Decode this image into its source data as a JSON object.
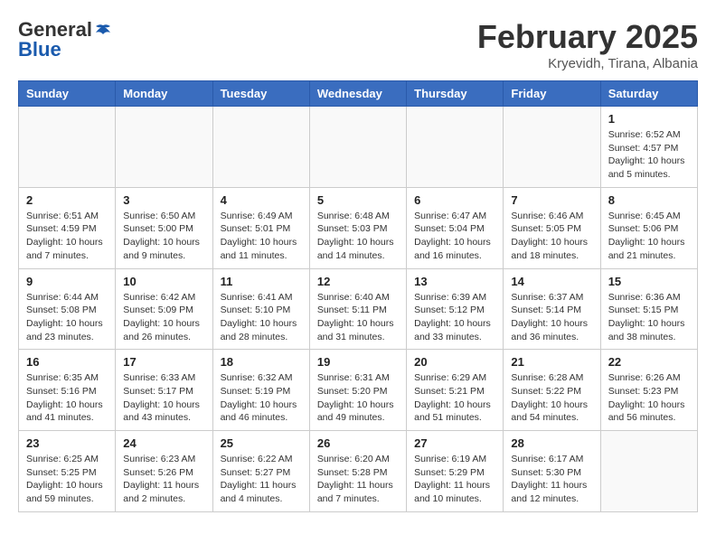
{
  "header": {
    "logo_general": "General",
    "logo_blue": "Blue",
    "title": "February 2025",
    "location": "Kryevidh, Tirana, Albania"
  },
  "weekdays": [
    "Sunday",
    "Monday",
    "Tuesday",
    "Wednesday",
    "Thursday",
    "Friday",
    "Saturday"
  ],
  "weeks": [
    [
      {
        "day": "",
        "info": ""
      },
      {
        "day": "",
        "info": ""
      },
      {
        "day": "",
        "info": ""
      },
      {
        "day": "",
        "info": ""
      },
      {
        "day": "",
        "info": ""
      },
      {
        "day": "",
        "info": ""
      },
      {
        "day": "1",
        "info": "Sunrise: 6:52 AM\nSunset: 4:57 PM\nDaylight: 10 hours\nand 5 minutes."
      }
    ],
    [
      {
        "day": "2",
        "info": "Sunrise: 6:51 AM\nSunset: 4:59 PM\nDaylight: 10 hours\nand 7 minutes."
      },
      {
        "day": "3",
        "info": "Sunrise: 6:50 AM\nSunset: 5:00 PM\nDaylight: 10 hours\nand 9 minutes."
      },
      {
        "day": "4",
        "info": "Sunrise: 6:49 AM\nSunset: 5:01 PM\nDaylight: 10 hours\nand 11 minutes."
      },
      {
        "day": "5",
        "info": "Sunrise: 6:48 AM\nSunset: 5:03 PM\nDaylight: 10 hours\nand 14 minutes."
      },
      {
        "day": "6",
        "info": "Sunrise: 6:47 AM\nSunset: 5:04 PM\nDaylight: 10 hours\nand 16 minutes."
      },
      {
        "day": "7",
        "info": "Sunrise: 6:46 AM\nSunset: 5:05 PM\nDaylight: 10 hours\nand 18 minutes."
      },
      {
        "day": "8",
        "info": "Sunrise: 6:45 AM\nSunset: 5:06 PM\nDaylight: 10 hours\nand 21 minutes."
      }
    ],
    [
      {
        "day": "9",
        "info": "Sunrise: 6:44 AM\nSunset: 5:08 PM\nDaylight: 10 hours\nand 23 minutes."
      },
      {
        "day": "10",
        "info": "Sunrise: 6:42 AM\nSunset: 5:09 PM\nDaylight: 10 hours\nand 26 minutes."
      },
      {
        "day": "11",
        "info": "Sunrise: 6:41 AM\nSunset: 5:10 PM\nDaylight: 10 hours\nand 28 minutes."
      },
      {
        "day": "12",
        "info": "Sunrise: 6:40 AM\nSunset: 5:11 PM\nDaylight: 10 hours\nand 31 minutes."
      },
      {
        "day": "13",
        "info": "Sunrise: 6:39 AM\nSunset: 5:12 PM\nDaylight: 10 hours\nand 33 minutes."
      },
      {
        "day": "14",
        "info": "Sunrise: 6:37 AM\nSunset: 5:14 PM\nDaylight: 10 hours\nand 36 minutes."
      },
      {
        "day": "15",
        "info": "Sunrise: 6:36 AM\nSunset: 5:15 PM\nDaylight: 10 hours\nand 38 minutes."
      }
    ],
    [
      {
        "day": "16",
        "info": "Sunrise: 6:35 AM\nSunset: 5:16 PM\nDaylight: 10 hours\nand 41 minutes."
      },
      {
        "day": "17",
        "info": "Sunrise: 6:33 AM\nSunset: 5:17 PM\nDaylight: 10 hours\nand 43 minutes."
      },
      {
        "day": "18",
        "info": "Sunrise: 6:32 AM\nSunset: 5:19 PM\nDaylight: 10 hours\nand 46 minutes."
      },
      {
        "day": "19",
        "info": "Sunrise: 6:31 AM\nSunset: 5:20 PM\nDaylight: 10 hours\nand 49 minutes."
      },
      {
        "day": "20",
        "info": "Sunrise: 6:29 AM\nSunset: 5:21 PM\nDaylight: 10 hours\nand 51 minutes."
      },
      {
        "day": "21",
        "info": "Sunrise: 6:28 AM\nSunset: 5:22 PM\nDaylight: 10 hours\nand 54 minutes."
      },
      {
        "day": "22",
        "info": "Sunrise: 6:26 AM\nSunset: 5:23 PM\nDaylight: 10 hours\nand 56 minutes."
      }
    ],
    [
      {
        "day": "23",
        "info": "Sunrise: 6:25 AM\nSunset: 5:25 PM\nDaylight: 10 hours\nand 59 minutes."
      },
      {
        "day": "24",
        "info": "Sunrise: 6:23 AM\nSunset: 5:26 PM\nDaylight: 11 hours\nand 2 minutes."
      },
      {
        "day": "25",
        "info": "Sunrise: 6:22 AM\nSunset: 5:27 PM\nDaylight: 11 hours\nand 4 minutes."
      },
      {
        "day": "26",
        "info": "Sunrise: 6:20 AM\nSunset: 5:28 PM\nDaylight: 11 hours\nand 7 minutes."
      },
      {
        "day": "27",
        "info": "Sunrise: 6:19 AM\nSunset: 5:29 PM\nDaylight: 11 hours\nand 10 minutes."
      },
      {
        "day": "28",
        "info": "Sunrise: 6:17 AM\nSunset: 5:30 PM\nDaylight: 11 hours\nand 12 minutes."
      },
      {
        "day": "",
        "info": ""
      }
    ]
  ]
}
